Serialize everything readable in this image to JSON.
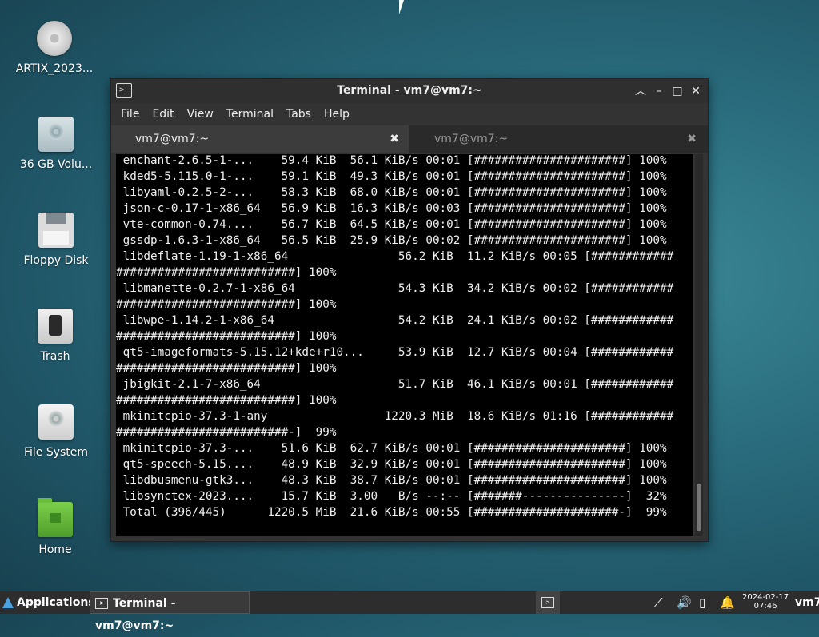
{
  "desktop": {
    "icons": [
      {
        "label": "ARTIX_2023..."
      },
      {
        "label": "36 GB Volu..."
      },
      {
        "label": "Floppy Disk"
      },
      {
        "label": "Trash"
      },
      {
        "label": "File System"
      },
      {
        "label": "Home"
      }
    ]
  },
  "window": {
    "title": "Terminal - vm7@vm7:~",
    "menu": [
      "File",
      "Edit",
      "View",
      "Terminal",
      "Tabs",
      "Help"
    ],
    "tabs": [
      {
        "label": "vm7@vm7:~",
        "close": "✖"
      },
      {
        "label": "vm7@vm7:~",
        "close": "✖"
      }
    ],
    "terminal_lines": [
      " enchant-2.6.5-1-...    59.4 KiB  56.1 KiB/s 00:01 [######################] 100%",
      " kded5-5.115.0-1-...    59.1 KiB  49.3 KiB/s 00:01 [######################] 100%",
      " libyaml-0.2.5-2-...    58.3 KiB  68.0 KiB/s 00:01 [######################] 100%",
      " json-c-0.17-1-x86_64   56.9 KiB  16.3 KiB/s 00:03 [######################] 100%",
      " vte-common-0.74....    56.7 KiB  64.5 KiB/s 00:01 [######################] 100%",
      " gssdp-1.6.3-1-x86_64   56.5 KiB  25.9 KiB/s 00:02 [######################] 100%",
      " libdeflate-1.19-1-x86_64                56.2 KiB  11.2 KiB/s 00:05 [############",
      "##########################] 100%",
      " libmanette-0.2.7-1-x86_64               54.3 KiB  34.2 KiB/s 00:02 [############",
      "##########################] 100%",
      " libwpe-1.14.2-1-x86_64                  54.2 KiB  24.1 KiB/s 00:02 [############",
      "##########################] 100%",
      " qt5-imageformats-5.15.12+kde+r10...     53.9 KiB  12.7 KiB/s 00:04 [############",
      "##########################] 100%",
      " jbigkit-2.1-7-x86_64                    51.7 KiB  46.1 KiB/s 00:01 [############",
      "##########################] 100%",
      " mkinitcpio-37.3-1-any                 1220.3 MiB  18.6 KiB/s 01:16 [############",
      "#########################-]  99%",
      " mkinitcpio-37.3-...    51.6 KiB  62.7 KiB/s 00:01 [######################] 100%",
      " qt5-speech-5.15....    48.9 KiB  32.9 KiB/s 00:01 [######################] 100%",
      " libdbusmenu-gtk3...    48.3 KiB  38.7 KiB/s 00:01 [######################] 100%",
      " libsynctex-2023....    15.7 KiB  3.00   B/s --:-- [#######---------------]  32%",
      " Total (396/445)      1220.5 MiB  21.6 KiB/s 00:55 [#####################-]  99%"
    ]
  },
  "taskbar": {
    "applications_label": "Applications",
    "task_label": "Terminal - vm7@vm7:~",
    "clock_date": "2024-02-17",
    "clock_time": "07:46",
    "user": "vm7"
  }
}
